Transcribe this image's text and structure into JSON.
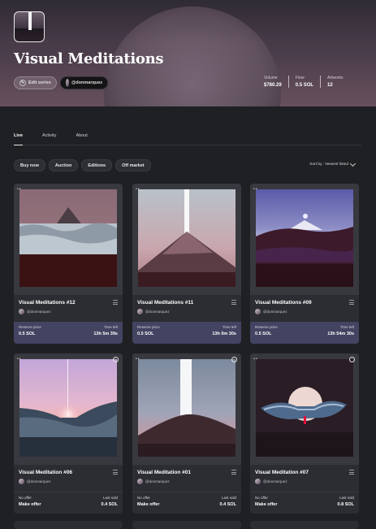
{
  "series": {
    "title": "Visual Meditations",
    "edit_label": "Edit series",
    "artist_handle": "@donmarquez"
  },
  "stats": [
    {
      "label": "Volume",
      "value": "$780.29"
    },
    {
      "label": "Floor",
      "value": "0.5 SOL"
    },
    {
      "label": "Artworks",
      "value": "12"
    }
  ],
  "tabs": [
    {
      "label": "Live",
      "active": true
    },
    {
      "label": "Activity",
      "active": false
    },
    {
      "label": "About",
      "active": false
    }
  ],
  "filters": [
    "Buy now",
    "Auction",
    "Editions",
    "Off market"
  ],
  "sort_label": "Sort by : Newest listed",
  "cards": [
    {
      "name": "Visual Meditations #12",
      "artist": "@donmarquez",
      "left_label": "Reserve price",
      "left_value": "0.5 SOL",
      "right_label": "Time left",
      "right_value": "13h 5m 39s",
      "type": "auction"
    },
    {
      "name": "Visual Meditations #11",
      "artist": "@donmarquez",
      "left_label": "Reserve price",
      "left_value": "0.5 SOL",
      "right_label": "Time left",
      "right_value": "13h 0m 30s",
      "type": "auction"
    },
    {
      "name": "Visual Meditations #09",
      "artist": "@donmarquez",
      "left_label": "Reserve price",
      "left_value": "0.5 SOL",
      "right_label": "Time left",
      "right_value": "13h 54m 30s",
      "type": "auction"
    },
    {
      "name": "Visual Meditation #06",
      "artist": "@donmarquez",
      "left_label": "No offer",
      "left_value": "Make offer",
      "right_label": "Last sold",
      "right_value": "0.4 SOL",
      "type": "sale"
    },
    {
      "name": "Visual Meditation #01",
      "artist": "@donmarquez",
      "left_label": "No offer",
      "left_value": "Make offer",
      "right_label": "Last sold",
      "right_value": "0.4 SOL",
      "type": "sale"
    },
    {
      "name": "Visual Meditation #07",
      "artist": "@donmarquez",
      "left_label": "No offer",
      "left_value": "Make offer",
      "right_label": "Last sold",
      "right_value": "0.8 SOL",
      "type": "sale"
    }
  ]
}
